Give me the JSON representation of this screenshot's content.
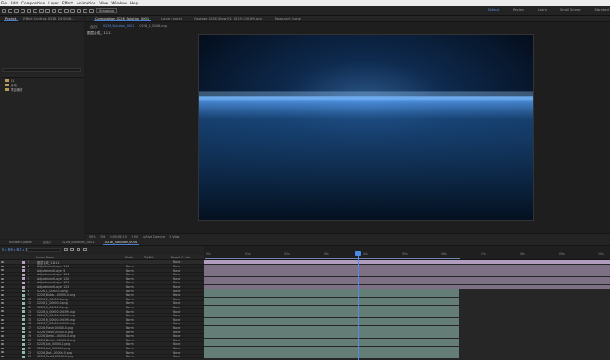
{
  "menu": [
    "File",
    "Edit",
    "Composition",
    "Layer",
    "Effect",
    "Animation",
    "View",
    "Window",
    "Help"
  ],
  "toolbar": {
    "snapping_label": "Snapping"
  },
  "workspaces": [
    {
      "label": "Default",
      "active": true
    },
    {
      "label": "Review",
      "active": false
    },
    {
      "label": "Learn",
      "active": false
    },
    {
      "label": "Small Screen",
      "active": false
    },
    {
      "label": "Standard",
      "active": false
    },
    {
      "label": "Libraries",
      "active": false
    }
  ],
  "project_panel": {
    "tabs": [
      "Project",
      "Effect Controls 0226_24_0048..."
    ],
    "folders": [
      "01",
      "自动",
      "项目素材"
    ]
  },
  "comp_panel": {
    "tabs": [
      "Composition 0226_Solution_0001",
      "Layer (none)",
      "Footage 0226_Glow_01_00151-00199.png",
      "Flowchart (none)"
    ],
    "subtabs": [
      "合成1",
      "0226_Solution_0001",
      "0226_1_0346.png"
    ],
    "comp_label": "图层合成_11111"
  },
  "viewer_bar": [
    "50%",
    "Full",
    "0:00:03:15",
    "+0.0",
    "Active Camera",
    "1 View"
  ],
  "timeline_tabs": [
    "Render Queue",
    "合成1",
    "0226_Solution_0001",
    "0226_Solution_0001"
  ],
  "timeline": {
    "timecode": "0:00:03:15",
    "columns": {
      "source": "Source Name",
      "mode": "Mode",
      "trkmat": "TrkMat",
      "parent": "Parent & Link"
    },
    "ruler": [
      "00s",
      "01s",
      "02s",
      "03s",
      "04s",
      "05s",
      "06s",
      "07s",
      "08s",
      "09s",
      "10s"
    ]
  },
  "layers": [
    {
      "num": "1",
      "name": "图层合成_11111",
      "mode": "",
      "parent": "None",
      "color": "#b7a2c4"
    },
    {
      "num": "2",
      "name": "Adjustment Layer 119",
      "mode": "Norm",
      "parent": "None",
      "color": "#b7a2c4"
    },
    {
      "num": "3",
      "name": "Adjustment Layer 9",
      "mode": "Norm",
      "parent": "None",
      "color": "#b7a2c4"
    },
    {
      "num": "4",
      "name": "Adjustment Layer 124",
      "mode": "Norm",
      "parent": "None",
      "color": "#b7a2c4"
    },
    {
      "num": "5",
      "name": "Adjustment Layer 120",
      "mode": "Norm",
      "parent": "None",
      "color": "#b7a2c4"
    },
    {
      "num": "6",
      "name": "Adjustment Layer 121",
      "mode": "Norm",
      "parent": "None",
      "color": "#b7a2c4"
    },
    {
      "num": "7",
      "name": "Adjustment Layer 122",
      "mode": "Norm",
      "parent": "None",
      "color": "#b7a2c4"
    },
    {
      "num": "8",
      "name": "0226_1_00000-0.png",
      "mode": "Norm",
      "parent": "None",
      "color": "#8fb8ae"
    },
    {
      "num": "9",
      "name": "0226_Bubbl...00000-0.png",
      "mode": "Norm",
      "parent": "None",
      "color": "#8fb8ae"
    },
    {
      "num": "10",
      "name": "0226_2_00000-0.png",
      "mode": "Norm",
      "parent": "None",
      "color": "#8fb8ae"
    },
    {
      "num": "11",
      "name": "0226_1_00000-0.png",
      "mode": "Norm",
      "parent": "None",
      "color": "#8fb8ae"
    },
    {
      "num": "12",
      "name": "0226_3_00000-0.png",
      "mode": "Norm",
      "parent": "None",
      "color": "#8fb8ae"
    },
    {
      "num": "13",
      "name": "0226_4_00000-00499.png",
      "mode": "Norm",
      "parent": "None",
      "color": "#8fb8ae"
    },
    {
      "num": "14",
      "name": "0226_5_00000-00499.png",
      "mode": "Norm",
      "parent": "None",
      "color": "#8fb8ae"
    },
    {
      "num": "15",
      "name": "0226_6_00000-00499.png",
      "mode": "Norm",
      "parent": "None",
      "color": "#8fb8ae"
    },
    {
      "num": "16",
      "name": "0226_7_00000-00499.png",
      "mode": "Norm",
      "parent": "None",
      "color": "#8fb8ae"
    },
    {
      "num": "17",
      "name": "0226_Flash_00000-0.png",
      "mode": "Norm",
      "parent": "None",
      "color": "#8fb8ae"
    },
    {
      "num": "18",
      "name": "0226_Flash_00000-0.png",
      "mode": "Norm",
      "parent": "None",
      "color": "#8fb8ae"
    },
    {
      "num": "19",
      "name": "0226_Defoll...00000-0.png",
      "mode": "Norm",
      "parent": "None",
      "color": "#8fb8ae"
    },
    {
      "num": "20",
      "name": "0226_Defoll...00000-0.png",
      "mode": "Norm",
      "parent": "None",
      "color": "#8fb8ae"
    },
    {
      "num": "21",
      "name": "0226_Lid_00000-0.png",
      "mode": "Norm",
      "parent": "None",
      "color": "#8fb8ae"
    },
    {
      "num": "22",
      "name": "0226_Lid_00000-0.png",
      "mode": "Norm",
      "parent": "None",
      "color": "#8fb8ae"
    },
    {
      "num": "23",
      "name": "0226_Dot...00000-0.png",
      "mode": "Norm",
      "parent": "None",
      "color": "#8fb8ae"
    },
    {
      "num": "24",
      "name": "0226_Fast6_00000-0.png",
      "mode": "Norm",
      "parent": "None",
      "color": "#8fb8ae"
    }
  ]
}
